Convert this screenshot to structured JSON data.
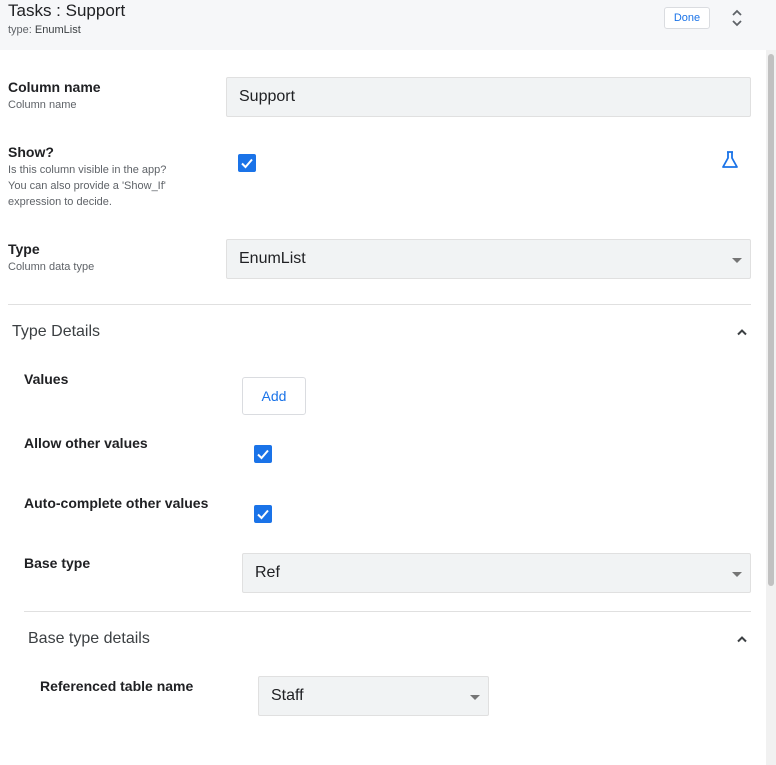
{
  "header": {
    "title": "Tasks : Support",
    "type_prefix": "type:",
    "type_value": "EnumList",
    "done_label": "Done"
  },
  "fields": {
    "column_name": {
      "label": "Column name",
      "description": "Column name",
      "value": "Support"
    },
    "show": {
      "label": "Show?",
      "description_line1": "Is this column visible in the app?",
      "description_line2": "You can also provide a 'Show_If'",
      "description_line3": "expression to decide.",
      "checked": true
    },
    "type": {
      "label": "Type",
      "description": "Column data type",
      "value": "EnumList"
    }
  },
  "type_details": {
    "title": "Type Details",
    "values_label": "Values",
    "add_label": "Add",
    "allow_other_label": "Allow other values",
    "allow_other_checked": true,
    "autocomplete_label": "Auto-complete other values",
    "autocomplete_checked": true,
    "base_type_label": "Base type",
    "base_type_value": "Ref"
  },
  "base_type_details": {
    "title": "Base type details",
    "ref_table_label": "Referenced table name",
    "ref_table_value": "Staff"
  },
  "icons": {
    "expand": "unfold-icon",
    "flask": "flask-icon",
    "chevron": "chevron-up-icon",
    "check": "check-icon"
  },
  "colors": {
    "accent": "#1a73e8",
    "header_bg": "#f6f7f9",
    "field_bg": "#f1f3f4"
  }
}
